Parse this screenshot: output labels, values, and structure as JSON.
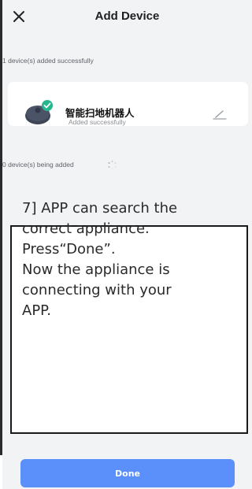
{
  "header": {
    "title": "Add Device"
  },
  "sections": {
    "added_label": "1 device(s) added successfully",
    "adding_label": "0 device(s) being added"
  },
  "device": {
    "name": "智能扫地机器人",
    "status": "Added successfully"
  },
  "annotation": {
    "lines": [
      "7] APP can search the",
      "correct appliance.",
      "Press“Done”.",
      "Now the appliance is",
      "connecting with your",
      "APP."
    ]
  },
  "footer": {
    "done_label": "Done"
  },
  "colors": {
    "accent": "#5b8ff9",
    "success": "#27b68f",
    "background": "#f2f3f5"
  },
  "icons": [
    "close-icon",
    "check-icon",
    "edit-icon",
    "loading-spinner-icon",
    "robot-vacuum-icon"
  ]
}
